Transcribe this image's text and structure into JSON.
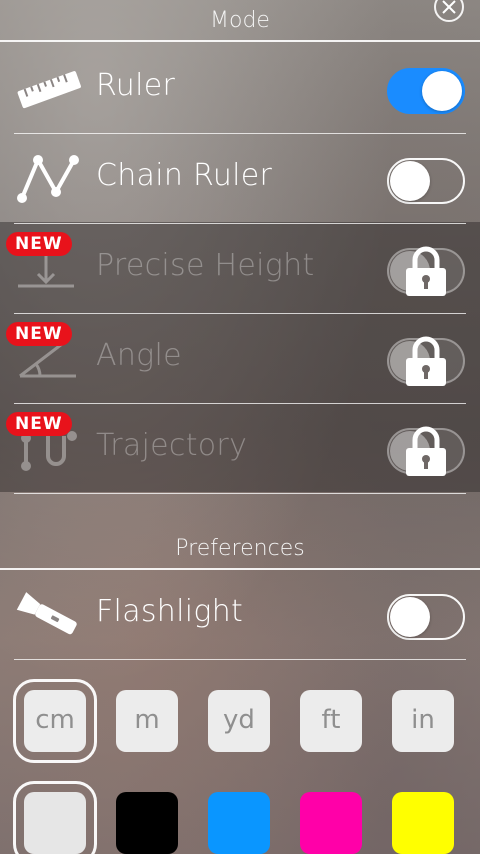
{
  "mode": {
    "title": "Mode",
    "items": [
      {
        "label": "Ruler",
        "enabled": true,
        "locked": false
      },
      {
        "label": "Chain Ruler",
        "enabled": false,
        "locked": false
      },
      {
        "label": "Precise Height",
        "enabled": false,
        "locked": true,
        "badge": "NEW"
      },
      {
        "label": "Angle",
        "enabled": false,
        "locked": true,
        "badge": "NEW"
      },
      {
        "label": "Trajectory",
        "enabled": false,
        "locked": true,
        "badge": "NEW"
      }
    ]
  },
  "preferences": {
    "title": "Preferences",
    "flashlight": {
      "label": "Flashlight",
      "enabled": false
    },
    "units": [
      {
        "label": "cm",
        "selected": true
      },
      {
        "label": "m",
        "selected": false
      },
      {
        "label": "yd",
        "selected": false
      },
      {
        "label": "ft",
        "selected": false
      },
      {
        "label": "in",
        "selected": false
      }
    ],
    "colors": [
      {
        "name": "white",
        "hex": "#e6e6e6",
        "selected": true
      },
      {
        "name": "black",
        "hex": "#000000",
        "selected": false
      },
      {
        "name": "blue",
        "hex": "#0a96ff",
        "selected": false
      },
      {
        "name": "magenta",
        "hex": "#ff00a8",
        "selected": false
      },
      {
        "name": "yellow",
        "hex": "#ffff00",
        "selected": false
      }
    ]
  },
  "icons": {
    "close": "close-icon",
    "ruler": "ruler-icon",
    "chain_ruler": "chain-ruler-icon",
    "precise_height": "precise-height-icon",
    "angle": "angle-icon",
    "trajectory": "trajectory-icon",
    "lock": "lock-icon",
    "flashlight": "flashlight-icon"
  },
  "colors": {
    "accent": "#1a8cff",
    "badge": "#e8121b"
  }
}
